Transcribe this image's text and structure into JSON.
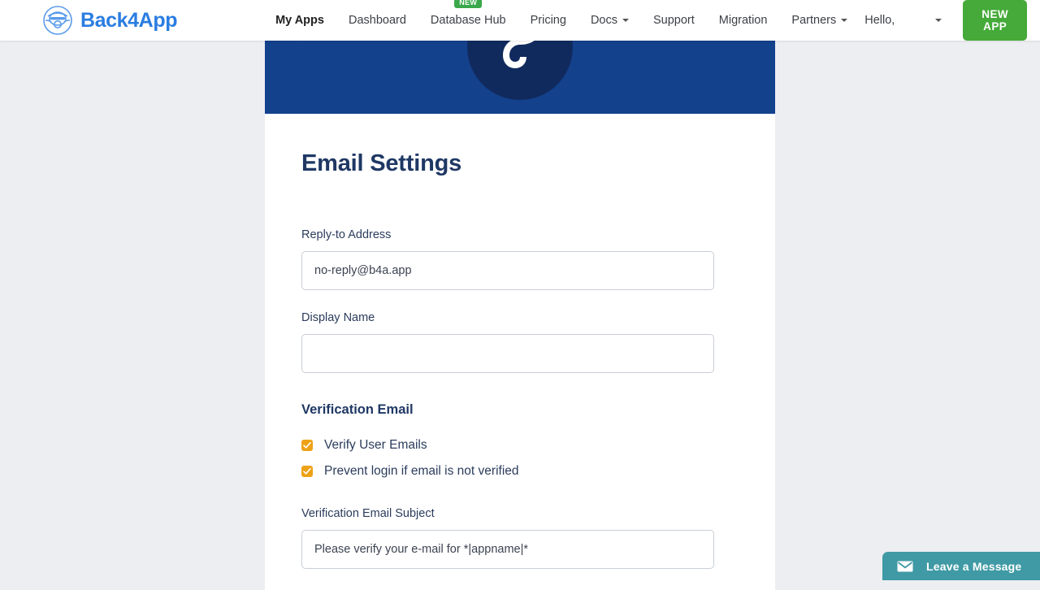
{
  "navbar": {
    "brand": "Back4App",
    "links": [
      {
        "label": "My Apps",
        "active": true,
        "caret": false,
        "badge": ""
      },
      {
        "label": "Dashboard",
        "active": false,
        "caret": false,
        "badge": ""
      },
      {
        "label": "Database Hub",
        "active": false,
        "caret": false,
        "badge": "NEW"
      },
      {
        "label": "Pricing",
        "active": false,
        "caret": false,
        "badge": ""
      },
      {
        "label": "Docs",
        "active": false,
        "caret": true,
        "badge": ""
      },
      {
        "label": "Support",
        "active": false,
        "caret": false,
        "badge": ""
      },
      {
        "label": "Migration",
        "active": false,
        "caret": false,
        "badge": ""
      },
      {
        "label": "Partners",
        "active": false,
        "caret": true,
        "badge": ""
      }
    ],
    "account_label": "Hello,",
    "new_app_label": "NEW APP"
  },
  "main": {
    "title": "Email Settings",
    "reply_to": {
      "label": "Reply-to Address",
      "value": "no-reply@b4a.app",
      "placeholder": ""
    },
    "display_name": {
      "label": "Display Name",
      "value": "",
      "placeholder": ""
    },
    "verification_section": {
      "heading": "Verification Email",
      "checkboxes": [
        {
          "label": "Verify User Emails",
          "checked": true
        },
        {
          "label": "Prevent login if email is not verified",
          "checked": true
        }
      ],
      "subject": {
        "label": "Verification Email Subject",
        "value": "Please verify your e-mail for *|appname|*",
        "placeholder": ""
      }
    }
  },
  "chat_widget": {
    "label": "Leave a Message"
  },
  "colors": {
    "brand_blue": "#2a7de1",
    "banner_blue": "#14418c",
    "banner_circle": "#102a5e",
    "new_app_green": "#45aa39",
    "badge_green": "#3aa84a",
    "checkbox_orange": "#eda217",
    "chat_teal": "#3f9aa5",
    "page_bg": "#eceef1",
    "heading_navy": "#1f3864"
  }
}
